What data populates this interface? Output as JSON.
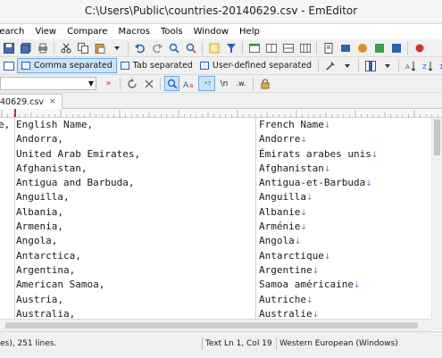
{
  "window": {
    "title": "C:\\Users\\Public\\countries-20140629.csv - EmEditor"
  },
  "menu": [
    "Search",
    "View",
    "Compare",
    "Macros",
    "Tools",
    "Window",
    "Help"
  ],
  "toolbar2": {
    "comma_separated": "Comma separated",
    "tab_separated": "Tab separated",
    "user_defined": "User-defined separated"
  },
  "toolbar3": {
    "regex": ".*?",
    "newline": "\\n",
    "wildcard": ".w."
  },
  "tab": {
    "label": "40629.csv",
    "close": "×"
  },
  "editor": {
    "rows": [
      {
        "c0": "e,",
        "c1": "English Name,",
        "c2": "French Name"
      },
      {
        "c0": "",
        "c1": "Andorra,",
        "c2": "Andorre"
      },
      {
        "c0": "",
        "c1": "United Arab Emirates,",
        "c2": "Émirats arabes unis"
      },
      {
        "c0": "",
        "c1": "Afghanistan,",
        "c2": "Afghanistan"
      },
      {
        "c0": "",
        "c1": "Antigua and Barbuda,",
        "c2": "Antigua-et-Barbuda"
      },
      {
        "c0": "",
        "c1": "Anguilla,",
        "c2": "Anguilla"
      },
      {
        "c0": "",
        "c1": "Albania,",
        "c2": "Albanie"
      },
      {
        "c0": "",
        "c1": "Armenia,",
        "c2": "Arménie"
      },
      {
        "c0": "",
        "c1": "Angola,",
        "c2": "Angola"
      },
      {
        "c0": "",
        "c1": "Antarctica,",
        "c2": "Antarctique"
      },
      {
        "c0": "",
        "c1": "Argentina,",
        "c2": "Argentine"
      },
      {
        "c0": "",
        "c1": "American Samoa,",
        "c2": "Samoa américaine"
      },
      {
        "c0": "",
        "c1": "Austria,",
        "c2": "Autriche"
      },
      {
        "c0": "",
        "c1": "Australia,",
        "c2": "Australie"
      }
    ],
    "eol_mark": "↓"
  },
  "status": {
    "left": "es), 251 lines.",
    "mode": "Text",
    "position": "Ln 1, Col 19",
    "encoding": "Western European (Windows)"
  },
  "colors": {
    "accent": "#2a63b0",
    "active_mode_bg": "#cce4f7",
    "eol": "#4a86c8"
  }
}
